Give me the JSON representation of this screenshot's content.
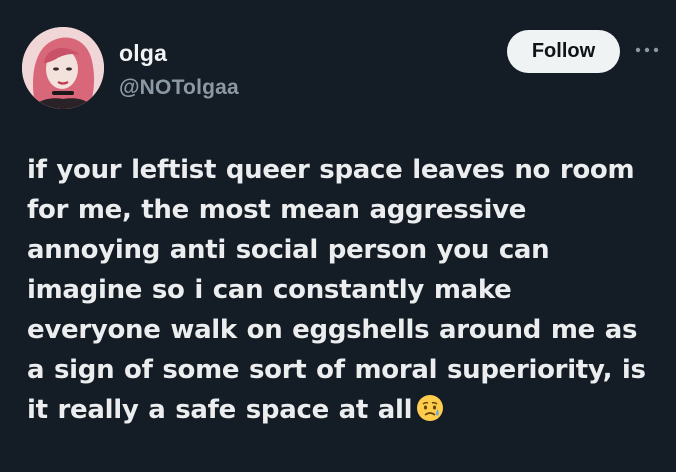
{
  "author": {
    "display_name": "olga",
    "handle": "@NOTolgaa",
    "avatar_icon": "profile-photo"
  },
  "actions": {
    "follow_label": "Follow",
    "more_icon": "more-horizontal-icon"
  },
  "tweet": {
    "lines": [
      "if your leftist queer space leaves no room",
      "for me, the most mean aggressive",
      "annoying anti social person you can",
      "imagine so i can constantly make",
      "everyone walk on eggshells around me as",
      "a sign of some sort of moral superiority, is",
      "it really a safe space at all"
    ],
    "trailing_emoji": "sad-but-relieved-face-emoji"
  },
  "colors": {
    "background": "#141d26",
    "text": "#ecedee",
    "secondary_text": "#8b98a5",
    "follow_button": "#eff3f4"
  }
}
